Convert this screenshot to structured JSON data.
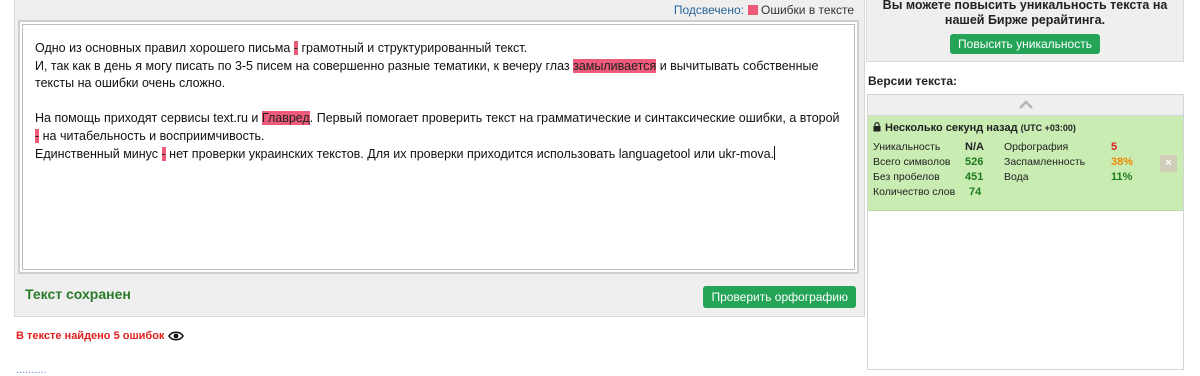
{
  "legend": {
    "label": "Подсвечено:",
    "errors_label": "Ошибки в тексте"
  },
  "editor": {
    "p1_a": "Одно из основных правил хорошего письма ",
    "p1_err1": "-",
    "p1_b": " грамотный и структурированный текст.",
    "p2_a": "И, так как в день я могу писать по 3-5 писем на совершенно разные тематики, к вечеру глаз ",
    "p2_err1": "замыливается",
    "p2_b": " и вычитывать собственные тексты на ошибки очень сложно.",
    "p3_a": "На помощь приходят сервисы text.ru и ",
    "p3_err1": "Главред",
    "p3_b": ". Первый помогает проверить текст на грамматические и синтаксические ошибки, а второй ",
    "p3_err2": "-",
    "p3_c": " на читабельность и восприимчивость.",
    "p4_a": "Единственный минус ",
    "p4_err1": "-",
    "p4_b": " нет проверки украинских текстов. Для их проверки приходится использовать languagetool или ukr-mova."
  },
  "status": {
    "saved": "Текст сохранен",
    "check_button": "Проверить орфографию"
  },
  "errors_found": "В тексте найдено 5 ошибок",
  "promo": {
    "text": "Вы можете повысить уникальность текста на нашей Бирже рерайтинга.",
    "button": "Повысить уникальность"
  },
  "versions": {
    "title": "Версии текста:",
    "items": [
      {
        "time": "Несколько секунд назад",
        "timezone": "(UTC +03:00)",
        "rows": [
          {
            "l1": "Уникальность",
            "v1": "N/A",
            "l2": "Орфография",
            "v2": "5"
          },
          {
            "l1": "Всего символов",
            "v1": "526",
            "l2": "Заспамленность",
            "v2": "38%"
          },
          {
            "l1": "Без пробелов",
            "v1": "451",
            "l2": "Вода",
            "v2": "11%"
          },
          {
            "l1": "Количество слов",
            "v1": "74",
            "l2": "",
            "v2": ""
          }
        ],
        "delete_label": "×"
      }
    ]
  },
  "colors": {
    "error_highlight": "#ee5a7a",
    "button_green": "#23a457",
    "version_bg": "#c9ecb3"
  }
}
